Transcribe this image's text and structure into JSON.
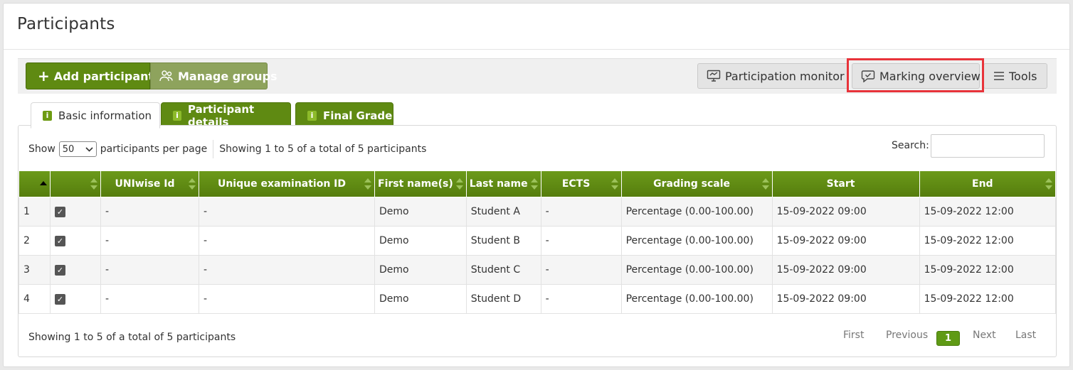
{
  "header": {
    "title": "Participants"
  },
  "toolbar": {
    "add_label": "Add participants",
    "groups_label": "Manage groups",
    "monitor_label": "Participation monitor",
    "marking_label": "Marking overview",
    "tools_label": "Tools"
  },
  "tabs": [
    {
      "label": "Basic information",
      "active": true
    },
    {
      "label": "Participant details",
      "active": false
    },
    {
      "label": "Final Grade",
      "active": false
    }
  ],
  "controls": {
    "show_label": "Show",
    "per_page_value": "50",
    "per_page_suffix": "participants per page",
    "showing_text": "Showing 1 to 5 of a total of 5 participants",
    "search_label": "Search:",
    "search_value": ""
  },
  "table": {
    "columns": [
      "",
      "",
      "UNIwise Id",
      "Unique examination ID",
      "First name(s)",
      "Last name",
      "ECTS",
      "Grading scale",
      "Start",
      "End"
    ],
    "rows": [
      {
        "num": "1",
        "checked": true,
        "uniwise": "-",
        "exam_id": "-",
        "first": "Demo",
        "last": "Student A",
        "ects": "-",
        "scale": "Percentage (0.00-100.00)",
        "start": "15-09-2022 09:00",
        "end": "15-09-2022 12:00"
      },
      {
        "num": "2",
        "checked": true,
        "uniwise": "-",
        "exam_id": "-",
        "first": "Demo",
        "last": "Student B",
        "ects": "-",
        "scale": "Percentage (0.00-100.00)",
        "start": "15-09-2022 09:00",
        "end": "15-09-2022 12:00"
      },
      {
        "num": "3",
        "checked": true,
        "uniwise": "-",
        "exam_id": "-",
        "first": "Demo",
        "last": "Student C",
        "ects": "-",
        "scale": "Percentage (0.00-100.00)",
        "start": "15-09-2022 09:00",
        "end": "15-09-2022 12:00"
      },
      {
        "num": "4",
        "checked": true,
        "uniwise": "-",
        "exam_id": "-",
        "first": "Demo",
        "last": "Student D",
        "ects": "-",
        "scale": "Percentage (0.00-100.00)",
        "start": "15-09-2022 09:00",
        "end": "15-09-2022 12:00"
      }
    ]
  },
  "footer": {
    "showing_text": "Showing 1 to 5 of a total of 5 participants",
    "first": "First",
    "previous": "Previous",
    "current_page": "1",
    "next": "Next",
    "last": "Last"
  },
  "colors": {
    "accent_green": "#5f8a12",
    "highlight_red": "#e8333a"
  }
}
